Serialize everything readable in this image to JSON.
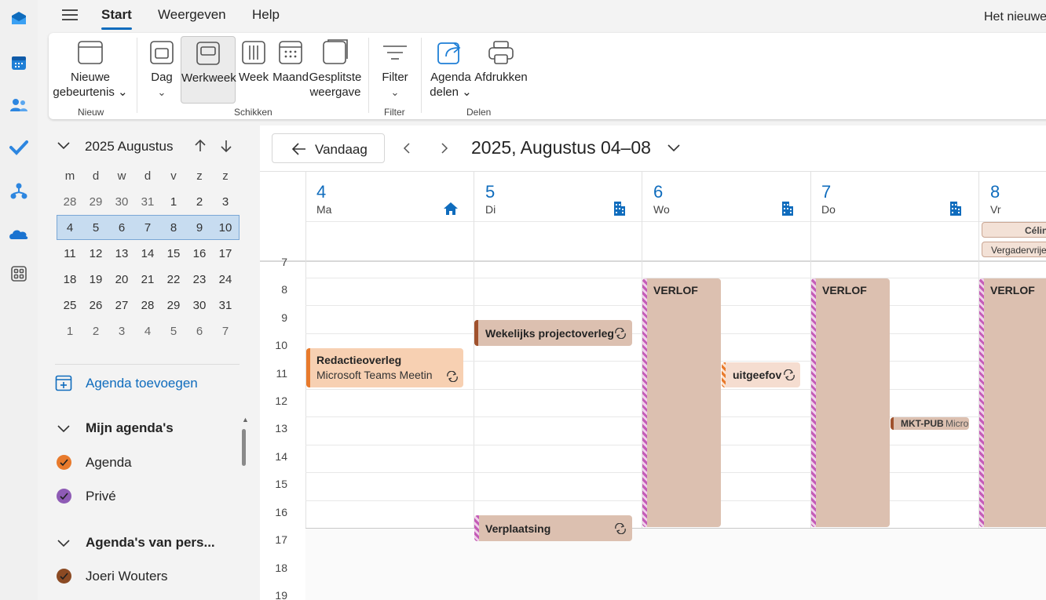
{
  "menu": {
    "start": "Start",
    "view": "Weergeven",
    "help": "Help",
    "right_title": "Het nieuwe"
  },
  "ribbon": {
    "new_event": [
      "Nieuwe",
      "gebeurtenis ⌄"
    ],
    "day": "Dag",
    "workweek": "Werkweek",
    "week": "Week",
    "month": "Maand",
    "split": [
      "Gesplitste",
      "weergave"
    ],
    "filter": "Filter",
    "share": [
      "Agenda",
      "delen ⌄"
    ],
    "print": "Afdrukken",
    "groups": {
      "new": "Nieuw",
      "arrange": "Schikken",
      "filter": "Filter",
      "share": "Delen"
    }
  },
  "minical": {
    "title": "2025 Augustus",
    "weekdays": [
      "m",
      "d",
      "w",
      "d",
      "v",
      "z",
      "z"
    ],
    "weeks": [
      [
        "28",
        "29",
        "30",
        "31",
        "1",
        "2",
        "3"
      ],
      [
        "4",
        "5",
        "6",
        "7",
        "8",
        "9",
        "10"
      ],
      [
        "11",
        "12",
        "13",
        "14",
        "15",
        "16",
        "17"
      ],
      [
        "18",
        "19",
        "20",
        "21",
        "22",
        "23",
        "24"
      ],
      [
        "25",
        "26",
        "27",
        "28",
        "29",
        "30",
        "31"
      ],
      [
        "1",
        "2",
        "3",
        "4",
        "5",
        "6",
        "7"
      ]
    ]
  },
  "sidebar": {
    "add_calendar": "Agenda toevoegen",
    "my_calendars": "Mijn agenda's",
    "calendars": [
      {
        "name": "Agenda",
        "color": "#e87a2c"
      },
      {
        "name": "Privé",
        "color": "#8e5bb5"
      }
    ],
    "people_calendars": "Agenda's van pers...",
    "people": [
      {
        "name": "Joeri Wouters",
        "color": "#8b4a23"
      }
    ]
  },
  "toolbar": {
    "today": "Vandaag",
    "range": "2025, Augustus 04–08"
  },
  "days": [
    {
      "num": "4",
      "name": "Ma"
    },
    {
      "num": "5",
      "name": "Di"
    },
    {
      "num": "6",
      "name": "Wo"
    },
    {
      "num": "7",
      "name": "Do"
    },
    {
      "num": "8",
      "name": "Vr"
    }
  ],
  "allday": {
    "ev1": "Célin",
    "ev2": "Vergadervrije"
  },
  "hours": [
    "7",
    "8",
    "9",
    "10",
    "11",
    "12",
    "13",
    "14",
    "15",
    "16",
    "17",
    "18",
    "19"
  ],
  "events": {
    "redactie_title": "Redactieoverleg",
    "redactie_sub": "Microsoft Teams Meetin",
    "wekelijks": "Wekelijks projectoverleg",
    "verlof": "VERLOF",
    "uitgeef": "uitgeefov",
    "mkt_title": "MKT-PUB",
    "mkt_sub": "Micro",
    "verplaatsing": "Verplaatsing"
  },
  "colors": {
    "accent": "#0f6cbd",
    "orange_event": "#f7d0b2",
    "brown_event": "#dcc0b0",
    "pink_stripe": "#c45cb7"
  }
}
